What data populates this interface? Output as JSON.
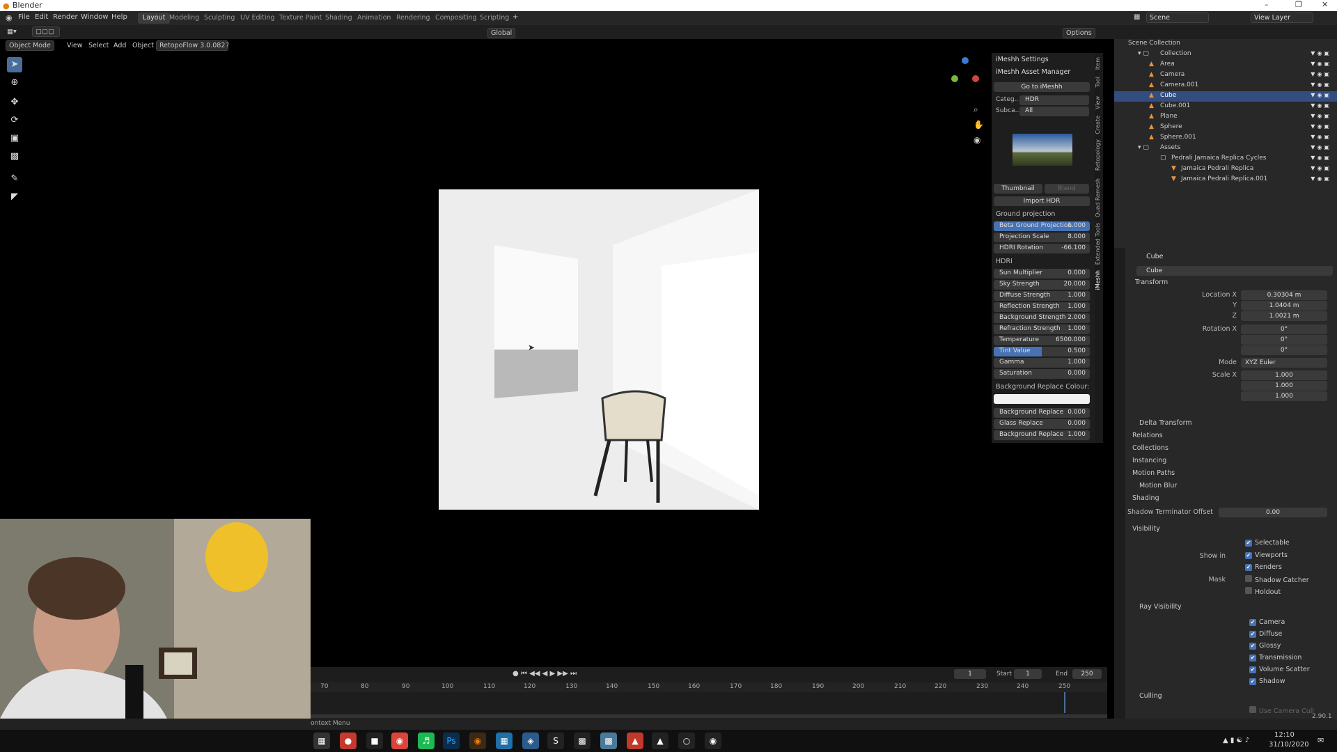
{
  "app": {
    "title": "Blender",
    "menu": [
      "File",
      "Edit",
      "Render",
      "Window",
      "Help"
    ],
    "workspaces": [
      "Layout",
      "Modeling",
      "Sculpting",
      "UV Editing",
      "Texture Paint",
      "Shading",
      "Animation",
      "Rendering",
      "Compositing",
      "Scripting"
    ],
    "scene": "Scene",
    "view_layer": "View Layer"
  },
  "header": {
    "mode": "Object Mode",
    "menus": [
      "View",
      "Select",
      "Add",
      "Object"
    ],
    "addon": "RetopoFlow 3.0.082",
    "orientation": "Global",
    "options": "Options"
  },
  "npanel": {
    "settings": "iMeshh Settings",
    "asset_manager": "iMeshh Asset Manager",
    "goto": "Go to iMeshh",
    "category_label": "Categ..",
    "category": "HDR",
    "subcat_label": "Subca..",
    "subcat": "All",
    "thumbnail": "Thumbnail",
    "blend": "Blend",
    "import": "Import HDR",
    "ground_title": "Ground projection",
    "ground": [
      {
        "l": "Beta Ground Projection",
        "v": "1.000"
      },
      {
        "l": "Projection Scale",
        "v": "8.000"
      },
      {
        "l": "HDRI Rotation",
        "v": "-66.100"
      }
    ],
    "hdri_title": "HDRI",
    "hdri": [
      {
        "l": "Sun Multiplier",
        "v": "0.000"
      },
      {
        "l": "Sky Strength",
        "v": "20.000"
      },
      {
        "l": "Diffuse Strength",
        "v": "1.000"
      },
      {
        "l": "Reflection Strength",
        "v": "1.000"
      },
      {
        "l": "Background Strength",
        "v": "2.000"
      },
      {
        "l": "Refraction Strength",
        "v": "1.000"
      },
      {
        "l": "Temperature",
        "v": "6500.000"
      },
      {
        "l": "Tint Value",
        "v": "0.500"
      },
      {
        "l": "Gamma",
        "v": "1.000"
      },
      {
        "l": "Saturation",
        "v": "0.000"
      }
    ],
    "bg_colour": "Background Replace Colour:",
    "replace": [
      {
        "l": "Background Replace",
        "v": "0.000"
      },
      {
        "l": "Glass Replace",
        "v": "0.000"
      },
      {
        "l": "Background Replace",
        "v": "1.000"
      }
    ],
    "tabs": [
      "Item",
      "Tool",
      "View",
      "Create",
      "Retopology",
      "Quad Remesh",
      "Extended Tools",
      "iMeshh"
    ]
  },
  "outliner": {
    "rows": [
      {
        "n": "Scene Collection",
        "d": 0
      },
      {
        "n": "Collection",
        "d": 1
      },
      {
        "n": "Area",
        "d": 2
      },
      {
        "n": "Camera",
        "d": 2
      },
      {
        "n": "Camera.001",
        "d": 2
      },
      {
        "n": "Cube",
        "d": 2,
        "sel": true
      },
      {
        "n": "Cube.001",
        "d": 2
      },
      {
        "n": "Plane",
        "d": 2
      },
      {
        "n": "Sphere",
        "d": 2
      },
      {
        "n": "Sphere.001",
        "d": 2
      },
      {
        "n": "Assets",
        "d": 1
      },
      {
        "n": "Pedrali Jamaica Replica Cycles",
        "d": 2
      },
      {
        "n": "Jamaica Pedrali Replica",
        "d": 3
      },
      {
        "n": "Jamaica Pedrali Replica.001",
        "d": 3
      }
    ]
  },
  "props": {
    "object": "Cube",
    "data": "Cube",
    "transform": "Transform",
    "location_label": "Location X",
    "loc": [
      "0.30304 m",
      "1.0404 m",
      "1.0021 m"
    ],
    "rotation_label": "Rotation X",
    "rot": [
      "0°",
      "0°",
      "0°"
    ],
    "mode_label": "Mode",
    "mode": "XYZ Euler",
    "scale_label": "Scale X",
    "scale": [
      "1.000",
      "1.000",
      "1.000"
    ],
    "y": "Y",
    "z": "Z",
    "panels": [
      "Delta Transform",
      "Relations",
      "Collections",
      "Instancing",
      "Motion Paths",
      "Motion Blur",
      "Shading"
    ],
    "sto_label": "Shadow Terminator Offset",
    "sto": "0.00",
    "visibility": "Visibility",
    "selectable": "Selectable",
    "show_in": "Show in",
    "viewports": "Viewports",
    "renders": "Renders",
    "mask": "Mask",
    "shadow_catcher": "Shadow Catcher",
    "holdout": "Holdout",
    "ray_vis": "Ray Visibility",
    "rays": [
      "Camera",
      "Diffuse",
      "Glossy",
      "Transmission",
      "Volume Scatter",
      "Shadow"
    ],
    "culling": "Culling",
    "use_camera_cull": "Use Camera Cull"
  },
  "timeline": {
    "frame": "1",
    "start_label": "Start",
    "start": "1",
    "end_label": "End",
    "end": "250",
    "ticks": [
      "70",
      "80",
      "90",
      "100",
      "110",
      "120",
      "130",
      "140",
      "150",
      "160",
      "170",
      "180",
      "190",
      "200",
      "210",
      "220",
      "230",
      "240",
      "250"
    ]
  },
  "status": {
    "left": "ontext Menu",
    "version": "2.90.1"
  },
  "taskbar": {
    "time": "12:10",
    "date": "31/10/2020"
  }
}
